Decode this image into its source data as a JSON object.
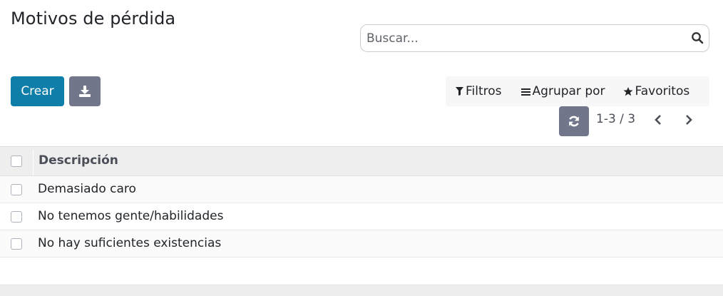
{
  "page": {
    "title": "Motivos de pérdida"
  },
  "search": {
    "placeholder": "Buscar..."
  },
  "toolbar": {
    "create_label": "Crear",
    "download_icon": "download-icon"
  },
  "filters": {
    "filters_label": "Filtros",
    "group_by_label": "Agrupar por",
    "favorites_label": "Favoritos"
  },
  "pager": {
    "value": "1-3 / 3"
  },
  "list": {
    "column_header": "Descripción",
    "rows": [
      {
        "label": "Demasiado caro"
      },
      {
        "label": "No tenemos gente/habilidades"
      },
      {
        "label": "No hay suficientes existencias"
      }
    ]
  },
  "colors": {
    "primary": "#0f7ea8",
    "secondary": "#71768b"
  }
}
